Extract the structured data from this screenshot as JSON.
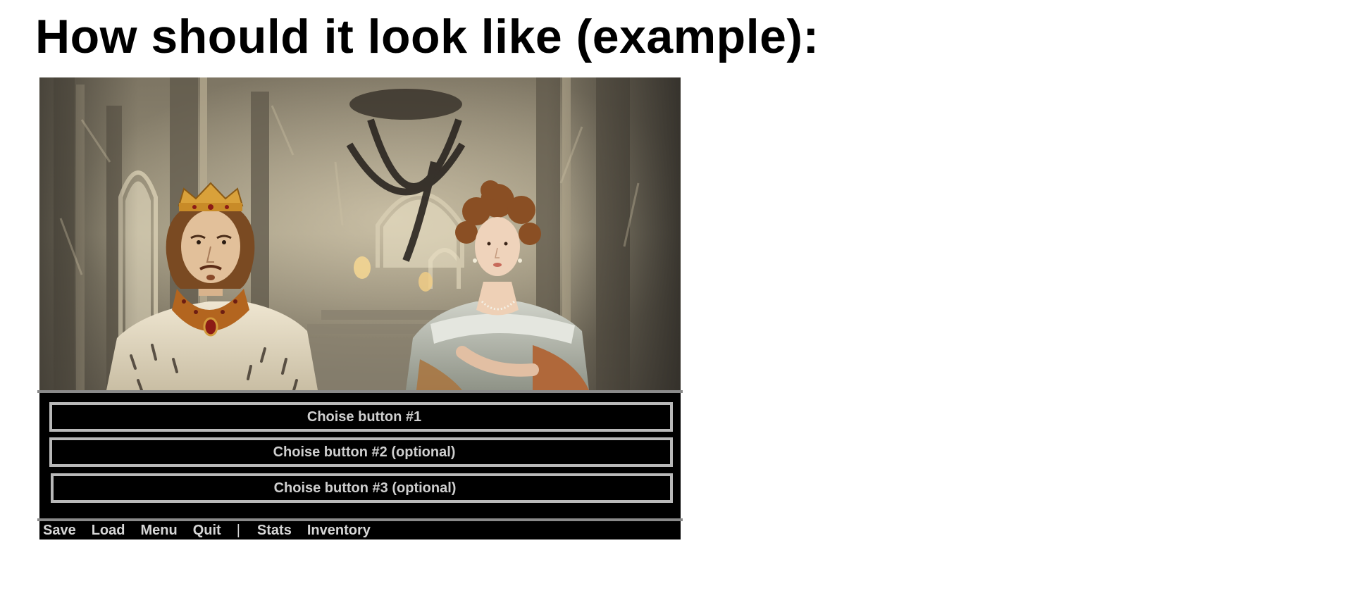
{
  "page": {
    "heading": "How should it look like (example):"
  },
  "scene": {
    "description_icon": "castle-hall-with-king-and-lady-portrait",
    "colors": {
      "background": "#8f8772",
      "ui_background": "#000000",
      "choice_border": "#b9b9b9",
      "choice_text": "#cfcfcf",
      "menu_text": "#d6d6d6",
      "divider": "#8a8a8a"
    }
  },
  "choices": [
    {
      "label": "Choise button #1"
    },
    {
      "label": "Choise button #2 (optional)"
    },
    {
      "label": "Choise button #3 (optional)"
    }
  ],
  "menu": {
    "save": "Save",
    "load": "Load",
    "menu": "Menu",
    "quit": "Quit",
    "separator": "|",
    "stats": "Stats",
    "inventory": "Inventory"
  }
}
